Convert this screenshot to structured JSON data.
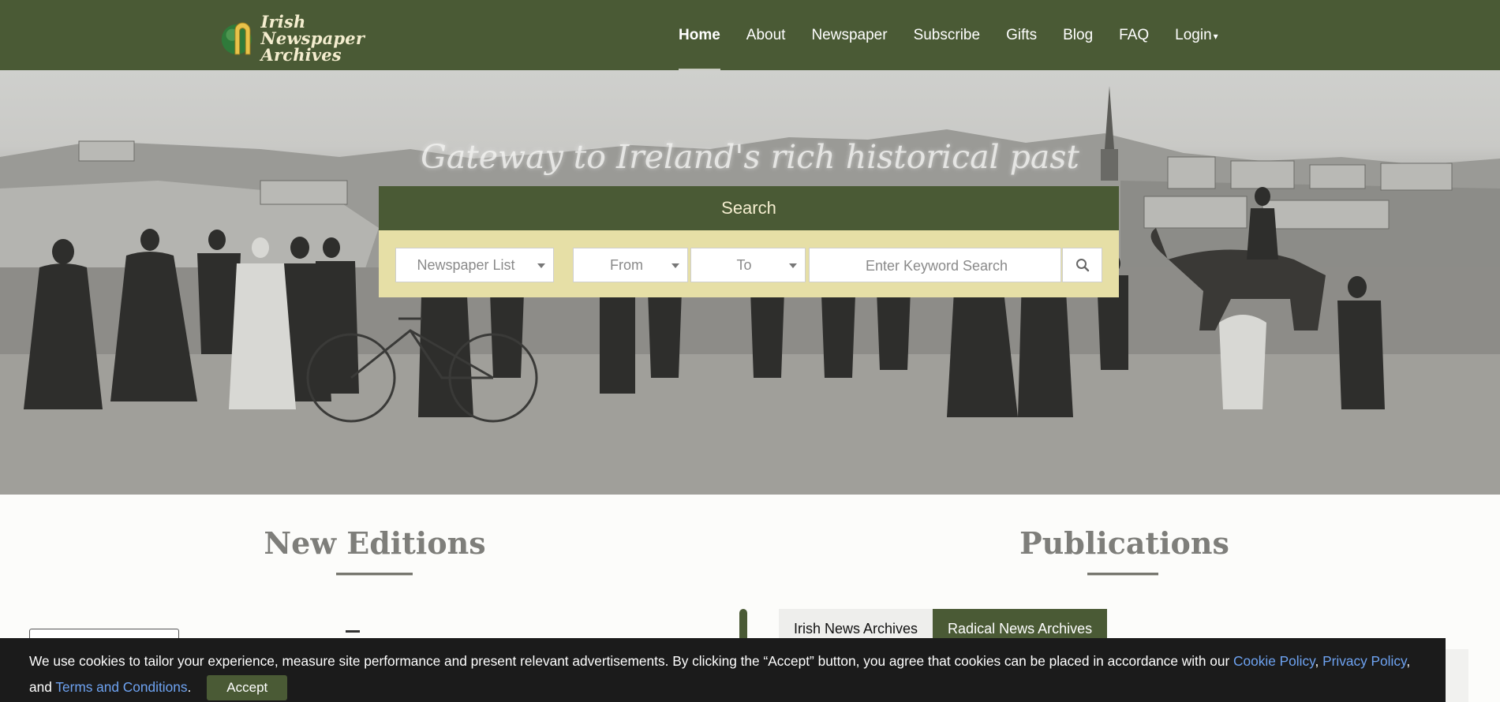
{
  "colors": {
    "brand_green": "#4a5a35",
    "cream": "#e6dfa6",
    "cookie_bg": "#1b1b1b",
    "link_blue": "#6ea3f2"
  },
  "logo": {
    "line1": "Irish Newspaper",
    "line2": "Archives"
  },
  "nav": {
    "items": [
      {
        "label": "Home",
        "active": true
      },
      {
        "label": "About"
      },
      {
        "label": "Newspaper"
      },
      {
        "label": "Subscribe"
      },
      {
        "label": "Gifts"
      },
      {
        "label": "Blog"
      },
      {
        "label": "FAQ"
      },
      {
        "label": "Login"
      }
    ]
  },
  "hero": {
    "tagline": "Gateway to Ireland's rich historical past"
  },
  "search": {
    "header": "Search",
    "newspaper_list": "Newspaper List",
    "from": "From",
    "to": "To",
    "keyword_placeholder": "Enter Keyword Search",
    "button_icon": "search-icon"
  },
  "sections": {
    "new_editions": "New Editions",
    "publications": "Publications"
  },
  "tabs": [
    {
      "label": "Irish News Archives"
    },
    {
      "label": "Radical News Archives",
      "active": true
    }
  ],
  "cookie": {
    "text_before": "We use cookies to tailor your experience, measure site performance and present relevant advertisements. By clicking the “Accept” button, you agree that cookies can be placed in accordance with our ",
    "cookie_policy": "Cookie Policy",
    "comma": ", ",
    "privacy_policy": "Privacy Policy",
    "and": ", and ",
    "terms": "Terms and Conditions",
    "period": ".",
    "accept": "Accept"
  }
}
